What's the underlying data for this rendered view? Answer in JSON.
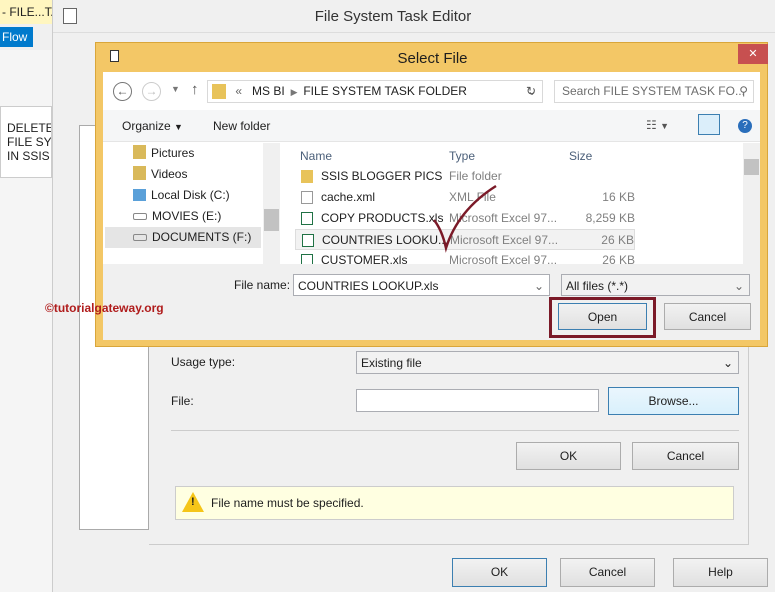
{
  "background": {
    "tab_label": "- FILE...TA",
    "flow_tab": "Flow",
    "side_text": [
      "DELETE",
      "FILE SY",
      "IN SSIS"
    ]
  },
  "watermark": "©tutorialgateway.org",
  "editor": {
    "title": "File System Task Editor",
    "usage_label": "Usage type:",
    "usage_value": "Existing file",
    "file_label": "File:",
    "file_value": "",
    "browse": "Browse...",
    "ok": "OK",
    "cancel": "Cancel",
    "warning": "File name must be specified.",
    "footer": {
      "ok": "OK",
      "cancel": "Cancel",
      "help": "Help"
    }
  },
  "dialog": {
    "title": "Select File",
    "close": "✕",
    "breadcrumb": {
      "prefix": "«",
      "parts": [
        "MS BI",
        "FILE SYSTEM TASK FOLDER"
      ]
    },
    "search_placeholder": "Search FILE SYSTEM TASK FO...",
    "organize": "Organize",
    "new_folder": "New folder",
    "nav": [
      {
        "label": "Pictures",
        "icon": "pictures-icon"
      },
      {
        "label": "Videos",
        "icon": "videos-icon"
      },
      {
        "label": "Local Disk (C:)",
        "icon": "local-disk-icon"
      },
      {
        "label": "MOVIES (E:)",
        "icon": "drive-icon"
      },
      {
        "label": "DOCUMENTS (F:)",
        "icon": "drive-icon"
      }
    ],
    "columns": [
      "Name",
      "Type",
      "Size"
    ],
    "files": [
      {
        "name": "SSIS BLOGGER PICS",
        "type": "File folder",
        "size": "",
        "icon": "folder"
      },
      {
        "name": "cache.xml",
        "type": "XML File",
        "size": "16 KB",
        "icon": "file"
      },
      {
        "name": "COPY PRODUCTS.xls",
        "type": "Microsoft Excel 97...",
        "size": "8,259 KB",
        "icon": "excel"
      },
      {
        "name": "COUNTRIES LOOKU...",
        "type": "Microsoft Excel 97...",
        "size": "26 KB",
        "icon": "excel"
      },
      {
        "name": "CUSTOMER.xls",
        "type": "Microsoft Excel 97...",
        "size": "26 KB",
        "icon": "excel"
      }
    ],
    "file_name_label": "File name:",
    "file_name_value": "COUNTRIES LOOKUP.xls",
    "filter": "All files (*.*)",
    "open": "Open",
    "cancel": "Cancel",
    "accent": "#f3c766",
    "highlight": "#7b1a28"
  }
}
